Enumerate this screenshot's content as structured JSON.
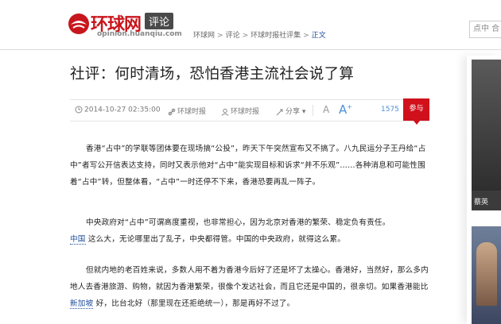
{
  "header": {
    "logo_text": "环球网",
    "logo_badge": "评论",
    "logo_domain": "opinion.huanqiu.com",
    "breadcrumb": [
      "环球网",
      "评论",
      "环球时报社评集",
      "正文"
    ],
    "breadcrumb_sep": ">",
    "search_placeholder": "点中 合"
  },
  "article": {
    "title": "社评：何时清场，恐怕香港主流社会说了算",
    "meta": {
      "datetime": "2014-10-27 02:35:00",
      "source1": "环球时报",
      "source2": "环球时报",
      "share": "分享",
      "font_small": "A",
      "font_large": "A",
      "font_large_sup": "+",
      "comment_count": "1575",
      "join_label": "参与"
    },
    "paragraphs": {
      "p1": "香港“占中”的学联等团体要在现场搞“公投”，昨天下午突然宣布又不搞了。八九民运分子王丹给“占中”者写公开信表达支持，同时又表示他对“占中”能实现目标和诉求“并不乐观”……各种消息和可能性围着“占中”转，但整体看，“占中”一时还停不下来，香港恐要再乱一阵子。",
      "p2_a": "中央政府对“占中”可谓高度重视，也非常担心，因为北京对香港的繁荣、稳定负有责任。",
      "p2_link": "中国",
      "p2_b": " 这么大，无论哪里出了乱子，中央都得管。中国的中央政府，就得这么累。",
      "p3_a": "但就内地的老百姓来说，多数人用不着为香港今后好了还是坏了太操心。香港好，当然好，那么多内地人去香港旅游、购物，就因为香港繁荣，很像个发达社会，而且它还是中国的，很亲切。如果香港能比 ",
      "p3_link": "新加坡",
      "p3_b": " 好，比台北好（那里现在还拒绝统一），那是再好不过了。"
    }
  },
  "sidebar": {
    "caption": "蔡英"
  },
  "colors": {
    "brand_red": "#c8161d",
    "link_blue": "#1f4f9c",
    "join_red": "#d0111b"
  }
}
